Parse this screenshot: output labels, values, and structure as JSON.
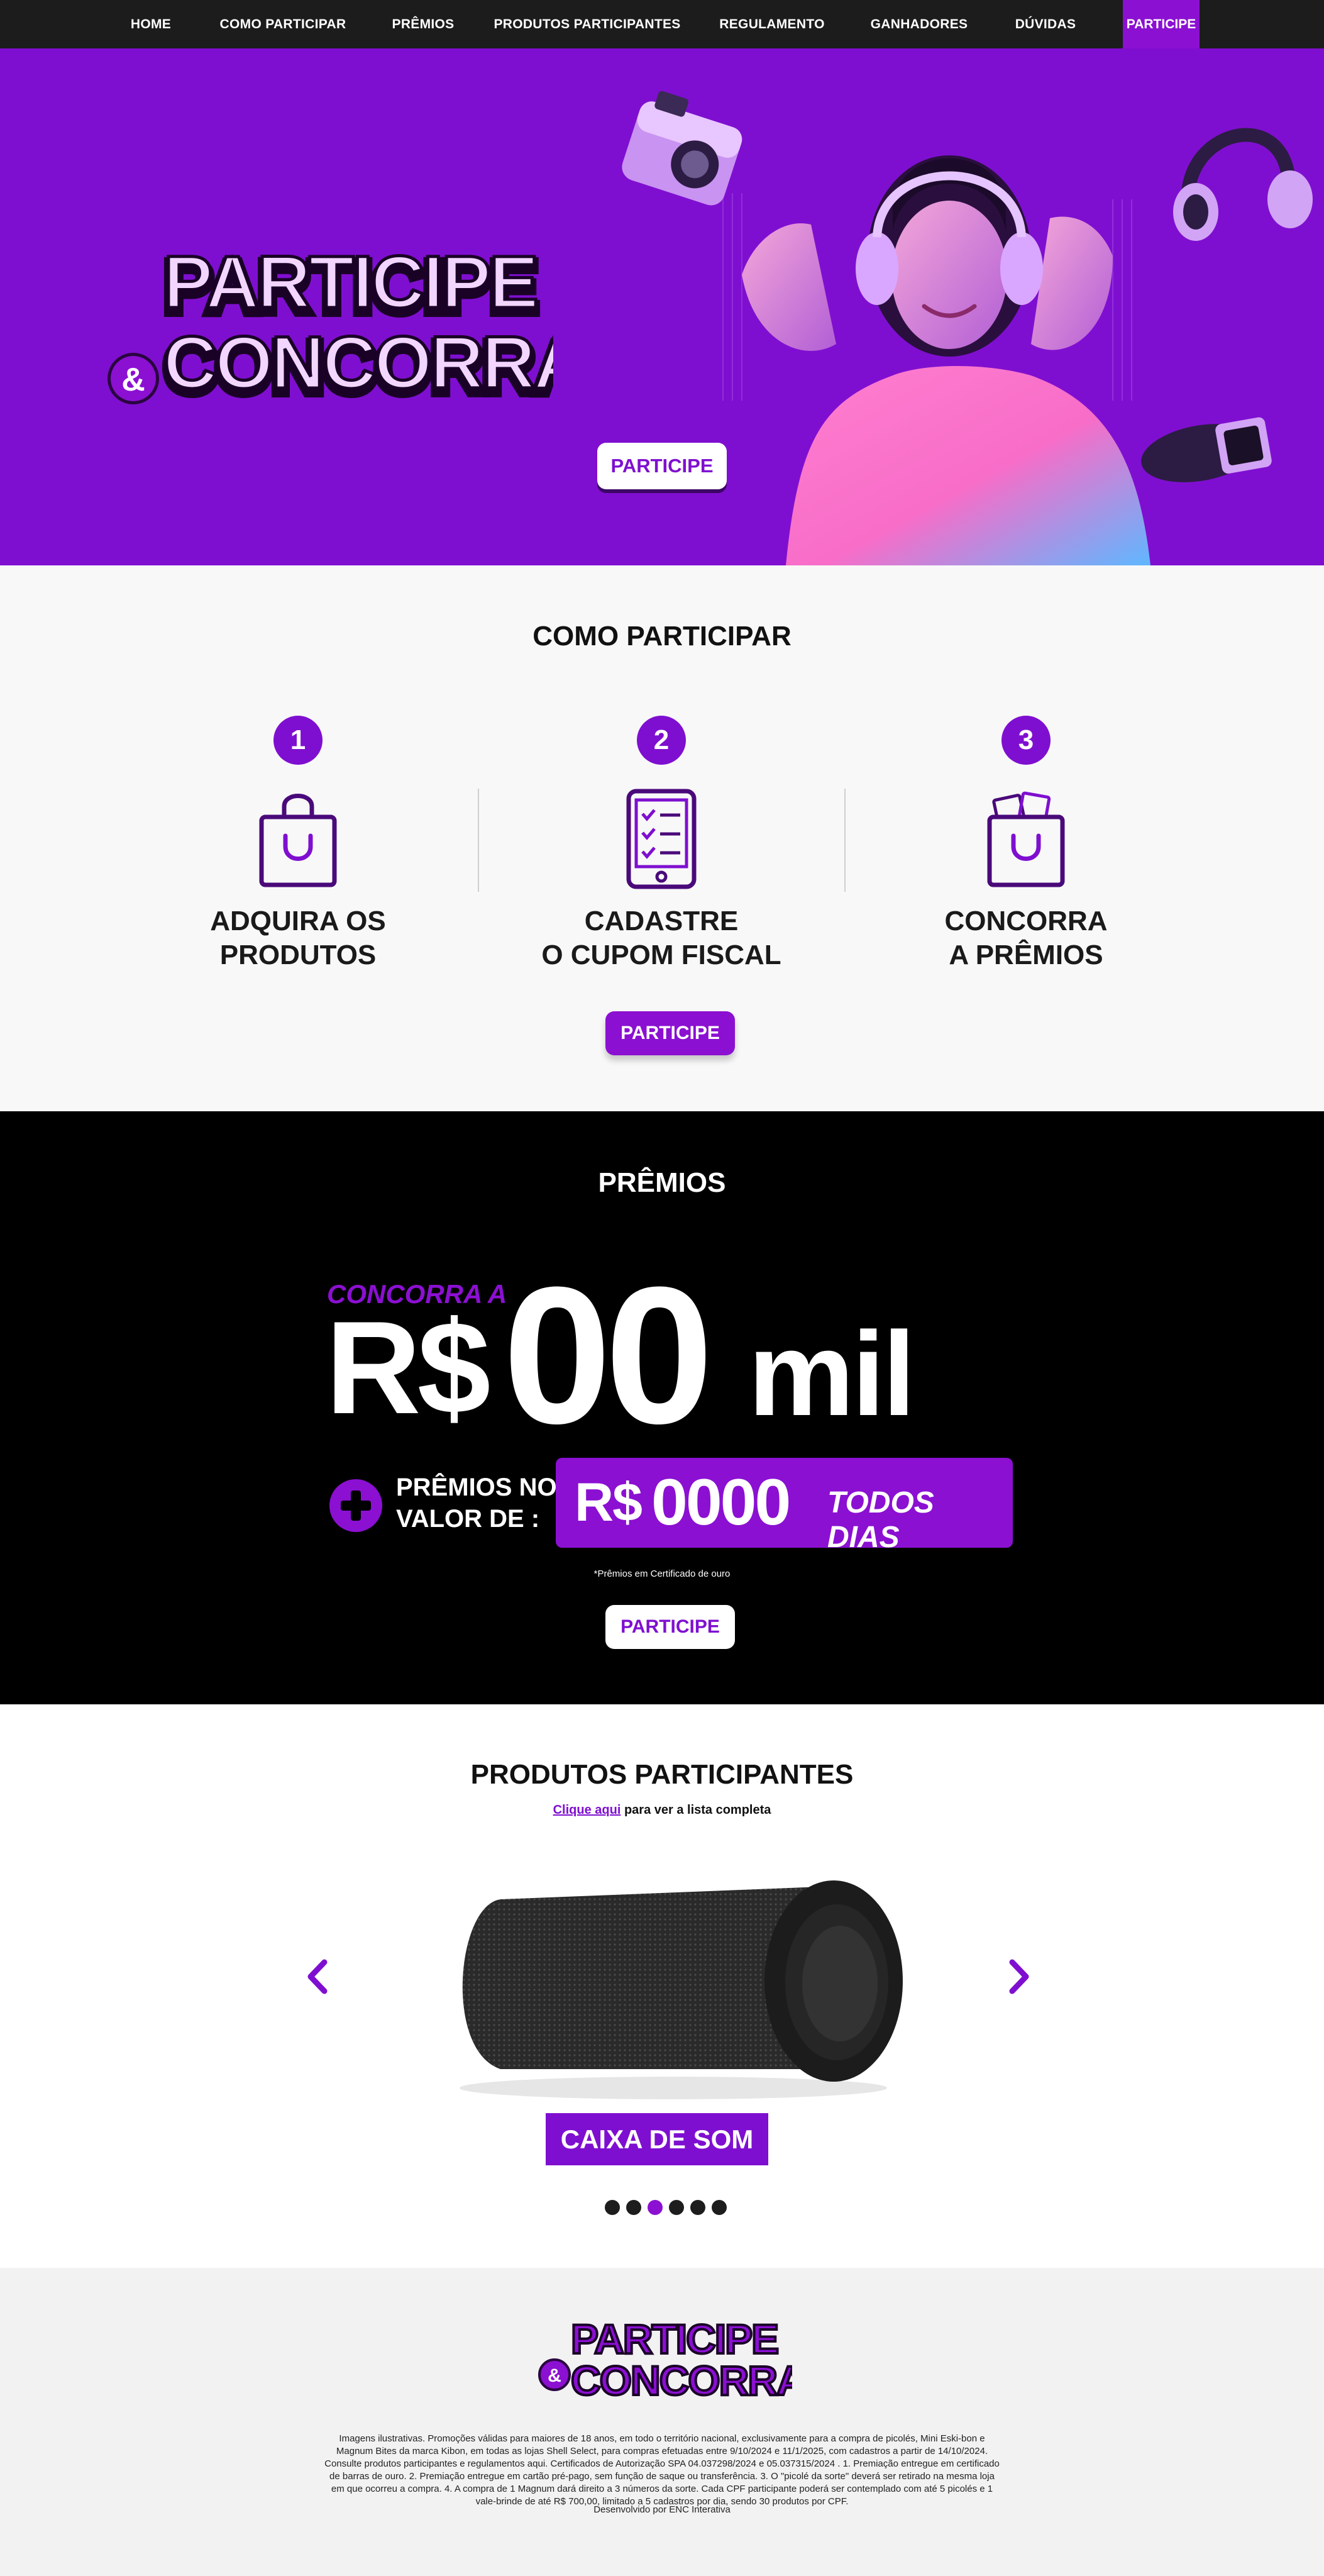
{
  "nav": {
    "items": [
      "HOME",
      "COMO PARTICIPAR",
      "PRÊMIOS",
      "PRODUTOS PARTICIPANTES",
      "REGULAMENTO",
      "GANHADORES",
      "DÚVIDAS"
    ],
    "cta": "PARTICIPE"
  },
  "hero": {
    "logo_line1": "PARTICIPE",
    "logo_amp": "&",
    "logo_line2": "CONCORRA",
    "button": "PARTICIPE"
  },
  "como": {
    "title": "COMO PARTICIPAR",
    "steps": [
      {
        "number": "1",
        "line1": "ADQUIRA OS",
        "line2": "PRODUTOS",
        "icon": "shopping-bag-icon"
      },
      {
        "number": "2",
        "line1": "CADASTRE",
        "line2": "O CUPOM FISCAL",
        "icon": "phone-checklist-icon"
      },
      {
        "number": "3",
        "line1": "CONCORRA",
        "line2": "A PRÊMIOS",
        "icon": "prize-bag-icon"
      }
    ],
    "button": "PARTICIPE"
  },
  "premios": {
    "title": "PRÊMIOS",
    "concorra_a": "CONCORRA A",
    "currency": "R$",
    "amount": "00",
    "unit": "mil",
    "premios_no_line1": "PRÊMIOS NO",
    "premios_no_line2": "VALOR DE :",
    "box_currency": "R$",
    "box_amount": "0000",
    "box_period": "TODOS DIAS",
    "note": "*Prêmios em Certificado de ouro",
    "button": "PARTICIPE"
  },
  "produtos": {
    "title": "PRODUTOS PARTICIPANTES",
    "link_text": "Clique aqui",
    "link_rest": " para ver a lista completa",
    "current_product": "CAIXA DE SOM",
    "slide_count": 6,
    "active_slide": 3
  },
  "footer": {
    "logo_line1": "PARTICIPE",
    "logo_amp": "&",
    "logo_line2": "CONCORRA",
    "legal": "Imagens ilustrativas. Promoções válidas para maiores de 18 anos, em todo o território nacional, exclusivamente para a compra de picolés, Mini Eski-bon e Magnum Bites da marca Kibon, em todas as lojas Shell Select, para compras efetuadas entre 9/10/2024 e 11/1/2025, com cadastros a partir de 14/10/2024. Consulte produtos participantes e regulamentos aqui. Certificados de Autorização SPA 04.037298/2024 e 05.037315/2024 . 1. Premiação entregue em certificado de barras de ouro. 2. Premiação entregue em cartão pré-pago, sem função de saque ou transferência. 3. O \"picolé da sorte\" deverá ser retirado na mesma loja em que ocorreu a compra. 4. A compra de 1 Magnum dará direito a 3 números da sorte. Cada CPF participante poderá ser contemplado com até 5 picolés e 1 vale-brinde de até R$ 700,00, limitado a 5 cadastros por dia, sendo 30 produtos por CPF.",
    "credit": "Desenvolvido por ENC Interativa"
  },
  "colors": {
    "brand_purple": "#7f0fd0",
    "accent_purple": "#8b10d2",
    "logo_lilac": "#f3d6ff",
    "nav_bg": "#1c1c1c",
    "prize_bg": "#000000"
  }
}
